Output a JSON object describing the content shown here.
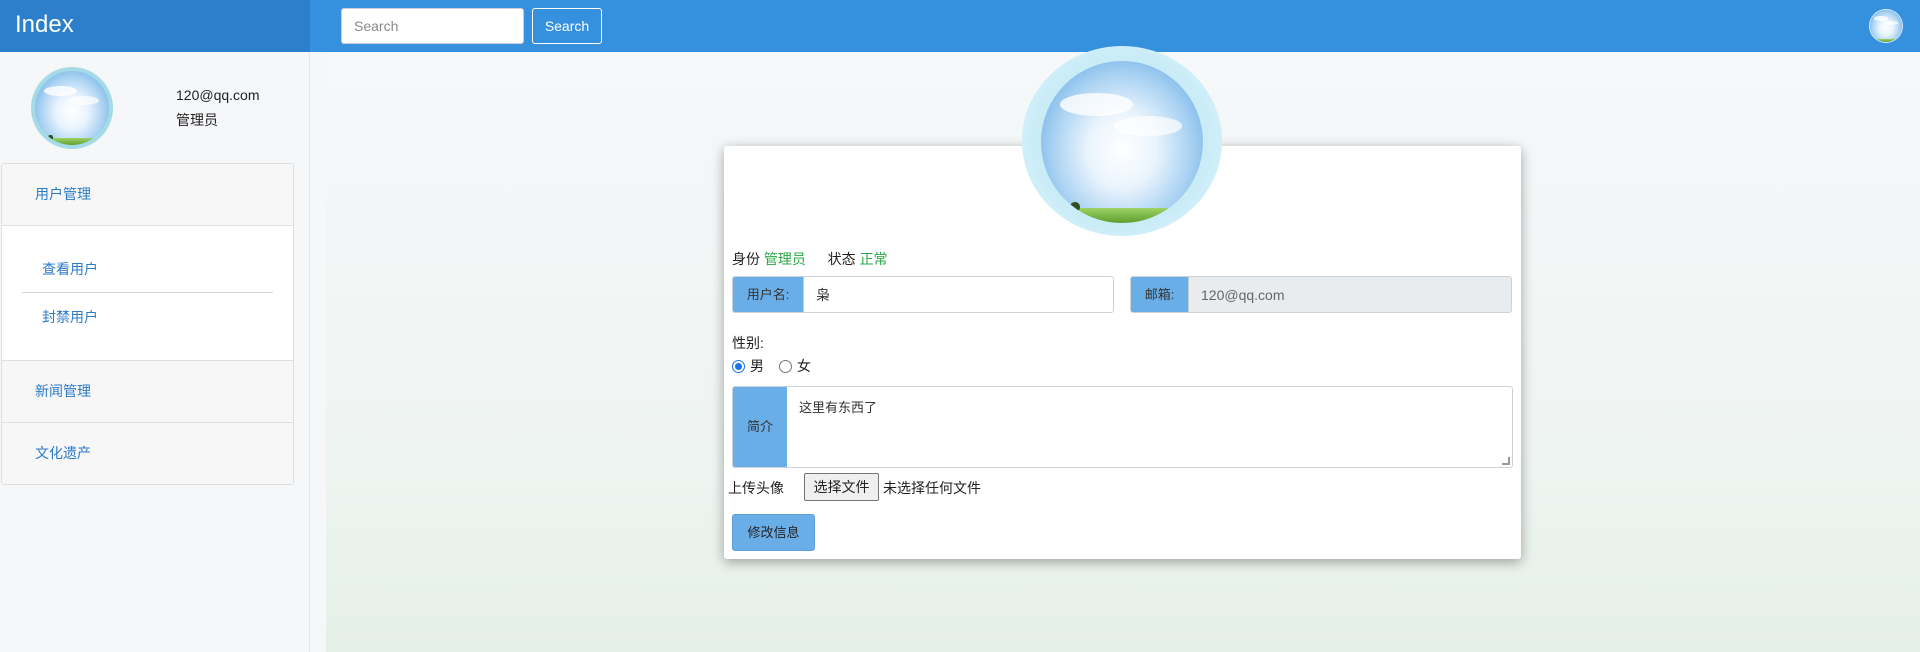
{
  "header": {
    "brand": "Index",
    "search_placeholder": "Search",
    "search_button": "Search"
  },
  "sidebar": {
    "email": "120@qq.com",
    "role": "管理员",
    "menu": {
      "user_management": "用户管理",
      "view_users": "查看用户",
      "ban_users": "封禁用户",
      "news_management": "新闻管理",
      "cultural_heritage": "文化遗产"
    }
  },
  "profile": {
    "identity_label": "身份",
    "identity_value": "管理员",
    "status_label": "状态",
    "status_value": "正常",
    "username_label": "用户名:",
    "username_value": "枭",
    "email_label": "邮箱:",
    "email_value": "120@qq.com",
    "gender_label": "性别:",
    "gender_options": [
      "男",
      "女"
    ],
    "gender_selected": "男",
    "intro_label": "简介",
    "intro_value": "这里有东西了",
    "upload_label": "上传头像",
    "file_button": "选择文件",
    "file_status": "未选择任何文件",
    "submit_button": "修改信息"
  },
  "colors": {
    "navbar": "#3590dd",
    "accent_green": "#28a745",
    "addon_blue": "#6aaee8"
  }
}
